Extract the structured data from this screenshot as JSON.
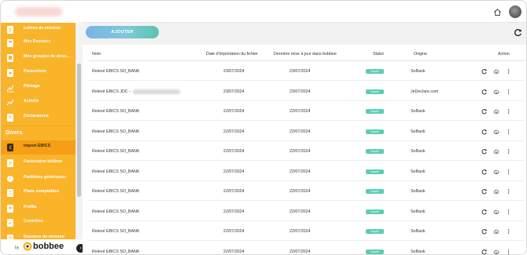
{
  "sidebar": {
    "items_top": [
      {
        "label": "Lettres de mission",
        "icon": "document-icon"
      },
      {
        "label": "Mes Dossiers",
        "icon": "folder-icon"
      },
      {
        "label": "Mes groupes de doss...",
        "icon": "folder-group-icon"
      },
      {
        "label": "Paramètres",
        "icon": "settings-icon"
      },
      {
        "label": "Pilotage",
        "icon": "chart-icon"
      },
      {
        "label": "Activité",
        "icon": "activity-icon"
      },
      {
        "label": "Déclarations",
        "icon": "declaration-icon"
      }
    ],
    "section": "Divers",
    "items_divers": [
      {
        "label": "Import EBICS",
        "icon": "import-icon",
        "active": true
      },
      {
        "label": "Facturation bobbee",
        "icon": "invoice-icon"
      },
      {
        "label": "Partitions génériques",
        "icon": "partition-icon"
      },
      {
        "label": "Plans comptables",
        "icon": "accounting-plan-icon"
      },
      {
        "label": "Profils",
        "icon": "profile-icon"
      },
      {
        "label": "Contrôles",
        "icon": "controls-icon"
      },
      {
        "label": "Dossiers de révision",
        "icon": "revision-icon"
      }
    ],
    "footer_by": "by",
    "footer_brand": "bobbee",
    "collapse_glyph": "‹"
  },
  "toolbar": {
    "add_label": "AJOUTER"
  },
  "table": {
    "headers": {
      "name": "Nom",
      "import_date": "Date d'importation du fichier",
      "last_update": "Dernière mise à jour dans bobbee",
      "status": "Statut",
      "origin": "Origine",
      "action": "Action"
    },
    "rows": [
      {
        "name": "Relevé EBICS SO_BANK",
        "import_date": "23/07/2024",
        "last_update": "23/07/2024",
        "status": "Importé",
        "origin": "SoBank",
        "redacted": false
      },
      {
        "name": "Relevé EBICS JDC - ",
        "import_date": "23/07/2024",
        "last_update": "23/07/2024",
        "status": "Importé",
        "origin": "JeDeclare.com",
        "redacted": true
      },
      {
        "name": "Relevé EBICS SO_BANK",
        "import_date": "22/07/2024",
        "last_update": "22/07/2024",
        "status": "Importé",
        "origin": "SoBank",
        "redacted": false
      },
      {
        "name": "Relevé EBICS SO_BANK",
        "import_date": "22/07/2024",
        "last_update": "22/07/2024",
        "status": "Importé",
        "origin": "SoBank",
        "redacted": false
      },
      {
        "name": "Relevé EBICS SO_BANK",
        "import_date": "22/07/2024",
        "last_update": "22/07/2024",
        "status": "Importé",
        "origin": "SoBank",
        "redacted": false
      },
      {
        "name": "Relevé EBICS SO_BANK",
        "import_date": "22/07/2024",
        "last_update": "22/07/2024",
        "status": "Importé",
        "origin": "SoBank",
        "redacted": false
      },
      {
        "name": "Relevé EBICS SO_BANK",
        "import_date": "22/07/2024",
        "last_update": "22/07/2024",
        "status": "Importé",
        "origin": "SoBank",
        "redacted": false
      },
      {
        "name": "Relevé EBICS SO_BANK",
        "import_date": "22/07/2024",
        "last_update": "22/07/2024",
        "status": "Importé",
        "origin": "SoBank",
        "redacted": false
      },
      {
        "name": "Relevé EBICS SO_BANK",
        "import_date": "22/07/2024",
        "last_update": "22/07/2024",
        "status": "Importé",
        "origin": "SoBank",
        "redacted": false
      },
      {
        "name": "Relevé EBICS SO_BANK",
        "import_date": "22/07/2024",
        "last_update": "22/07/2024",
        "status": "Importé",
        "origin": "SoBank",
        "redacted": false
      }
    ],
    "row_actions": [
      "refresh-icon",
      "cloud-upload-icon",
      "more-vertical-icon"
    ]
  },
  "colors": {
    "sidebar": "#f9b42a",
    "sidebar_active": "#f49f16",
    "status_badge": "#5ccdb3",
    "add_button_start": "#7ab3e6",
    "add_button_end": "#5bc4b0"
  }
}
